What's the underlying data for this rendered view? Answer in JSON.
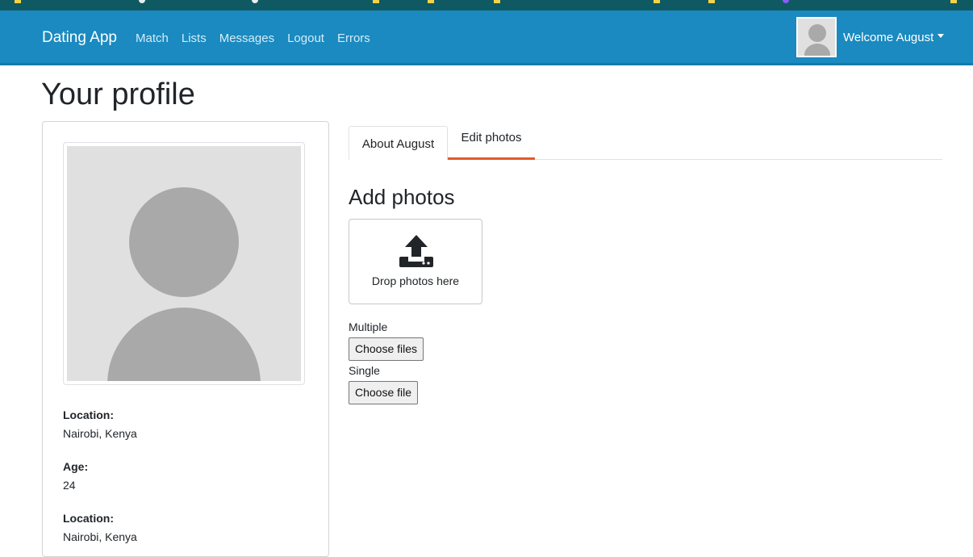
{
  "navbar": {
    "brand": "Dating App",
    "links": [
      "Match",
      "Lists",
      "Messages",
      "Logout",
      "Errors"
    ],
    "welcome": "Welcome August",
    "color": "#1a8ac0"
  },
  "page": {
    "title": "Your profile"
  },
  "profile": {
    "fields": [
      {
        "label": "Location:",
        "value": "Nairobi, Kenya"
      },
      {
        "label": "Age:",
        "value": "24"
      },
      {
        "label": "Location:",
        "value": "Nairobi, Kenya"
      }
    ]
  },
  "tabs": {
    "about": "About August",
    "edit": "Edit photos",
    "active": "Edit photos",
    "active_color": "#e05a2b"
  },
  "photos": {
    "title": "Add photos",
    "drop_text": "Drop photos here",
    "icon": "upload-icon",
    "multiple_label": "Multiple",
    "multiple_button": "Choose files",
    "single_label": "Single",
    "single_button": "Choose file"
  }
}
